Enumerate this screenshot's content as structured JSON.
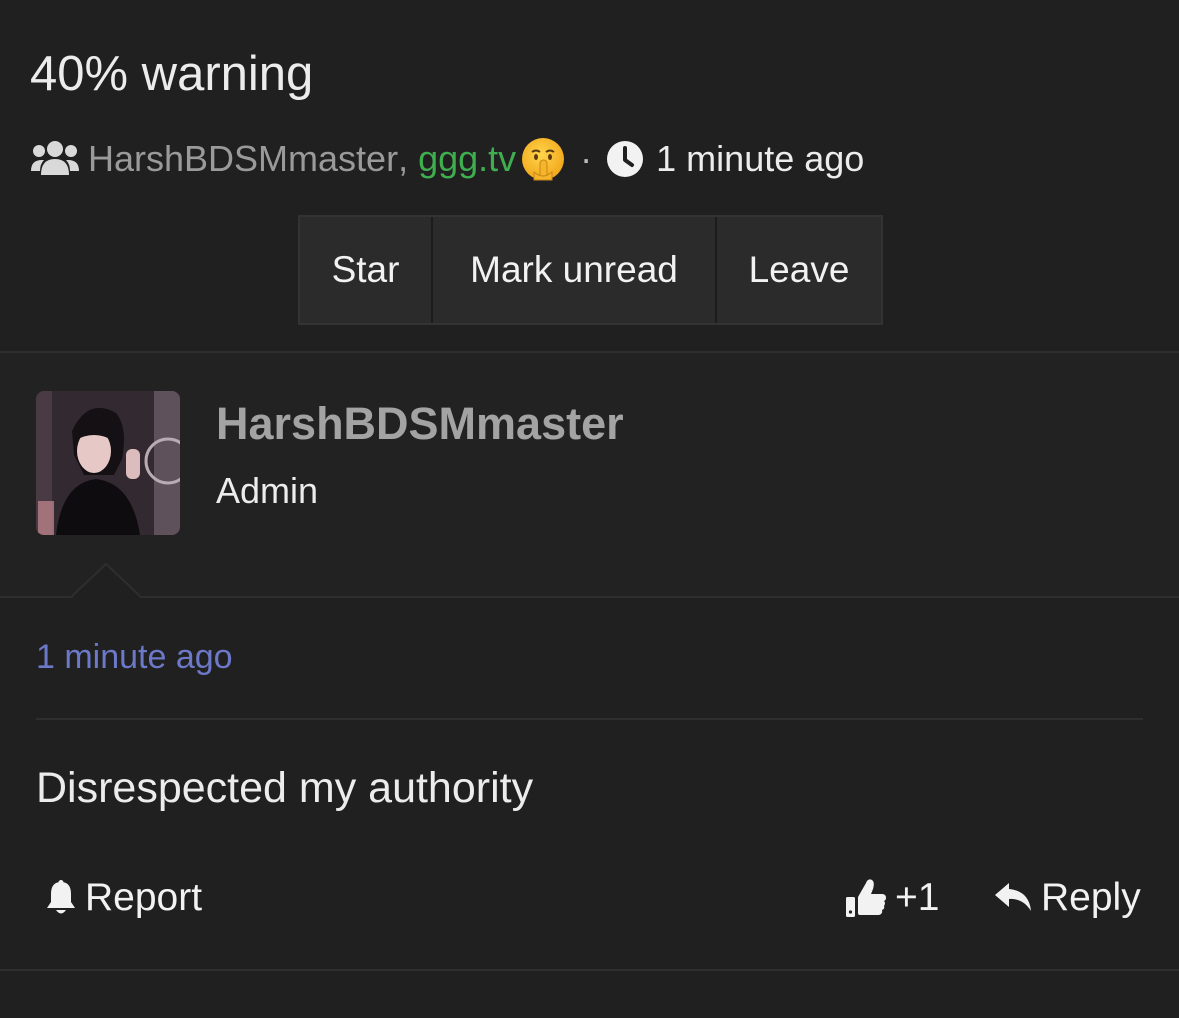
{
  "thread": {
    "title": "40% warning",
    "participants": [
      {
        "name": "HarshBDSMmaster",
        "color": "#9a9a9a"
      },
      {
        "name": "ggg.tv",
        "color": "#3fae4f"
      }
    ],
    "participant_separator": ",",
    "emoji_icon": "shushing-face-emoji",
    "dot_separator": "·",
    "updated": "1 minute ago"
  },
  "buttons": {
    "star": "Star",
    "mark_unread": "Mark unread",
    "leave": "Leave"
  },
  "post": {
    "author": "HarshBDSMmaster",
    "role": "Admin",
    "time": "1 minute ago",
    "body": "Disrespected my authority",
    "actions": {
      "report": "Report",
      "like": "+1",
      "reply": "Reply"
    }
  },
  "colors": {
    "background": "#202020",
    "link_time": "#6c78c8",
    "green_link": "#3fae4f"
  }
}
